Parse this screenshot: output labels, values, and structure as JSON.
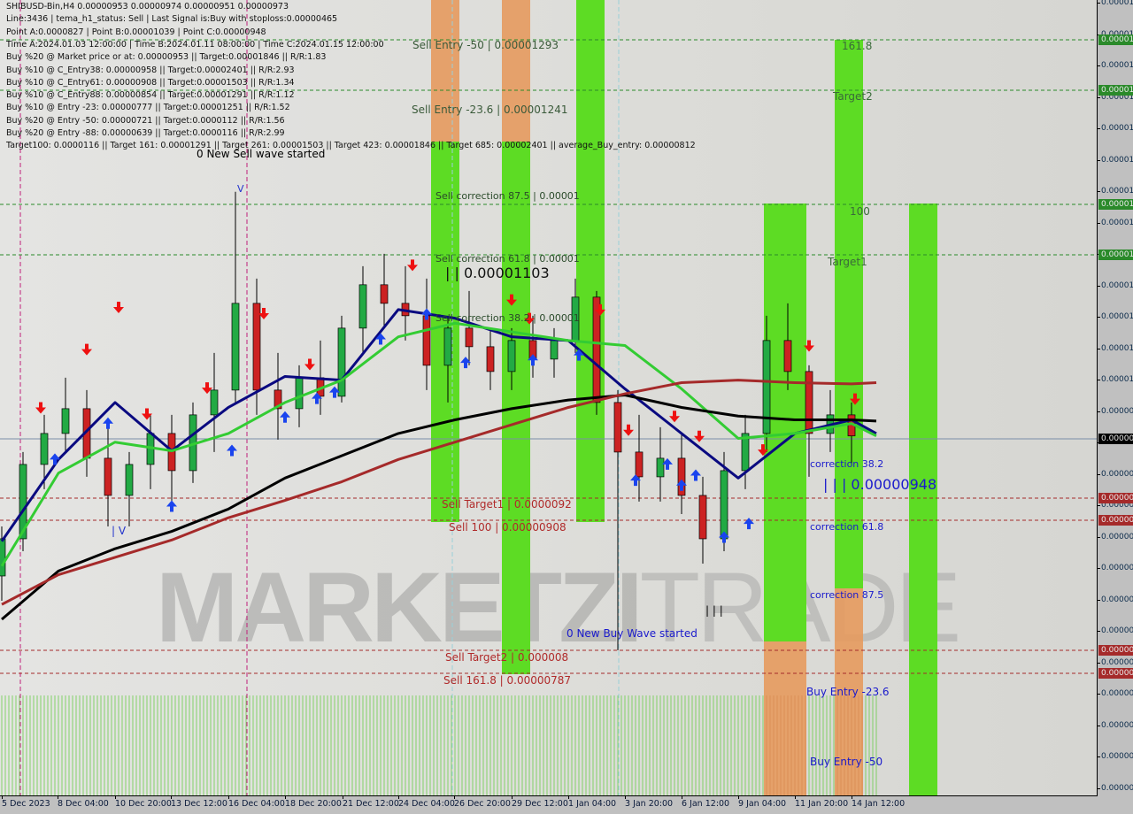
{
  "header": {
    "lines": [
      "SHIBUSD-Bin,H4  0.00000953 0.00000974 0.00000951 0.00000973",
      "Line:3436 | tema_h1_status: Sell | Last Signal is:Buy with stoploss:0.00000465",
      "Point A:0.0000827 | Point B:0.00001039 | Point C:0.00000948",
      "Time A:2024.01.03 12:00:00 | Time B:2024.01.11 08:00:00 | Time C:2024.01.15 12:00:00",
      "Buy %20 @ Market price or at: 0.00000953 || Target:0.00001846 || R/R:1.83",
      "Buy %10 @ C_Entry38: 0.00000958 || Target:0.00002401 || R/R:2.93",
      "Buy %10 @ C_Entry61: 0.00000908 || Target:0.00001503 || R/R:1.34",
      "Buy %10 @ C_Entry88: 0.00000854 || Target:0.00001291 || R/R:1.12",
      "Buy %10 @ Entry -23: 0.00000777 || Target:0.00001251 || R/R:1.52",
      "Buy %20 @ Entry -50: 0.00000721 || Target:0.0000112 || R/R:1.56",
      "Buy %20 @ Entry -88: 0.00000639 || Target:0.0000116 || R/R:2.99",
      "Target100: 0.0000116 || Target 161: 0.00001291 || Target 261: 0.00001503 || Target 423: 0.00001846 || Target 685: 0.00002401 || average_Buy_entry: 0.00000812"
    ]
  },
  "annotations": {
    "sell_entry_50": "Sell Entry -50 | 0.00001293",
    "sell_entry_236": "Sell Entry -23.6 | 0.00001241",
    "sell_corr_875": "Sell correction 87.5 | 0.00001",
    "sell_corr_618": "Sell correction 61.8 | 0.00001",
    "sell_corr_382": "Sell correction 38.2 | 0.00001",
    "point_b": "| | 0.00001103",
    "point_c": "| | | 0.00000948",
    "new_sell_wave": "0 New Sell wave started",
    "new_buy_wave": "0 New Buy Wave started",
    "sell_target1": "Sell Target1 | 0.0000092",
    "sell_100": "Sell 100 | 0.00000908",
    "sell_target2": "Sell Target2 | 0.000008",
    "sell_1618": "Sell 161.8 | 0.00000787",
    "t1618": "161.8",
    "target2": "Target2",
    "t100": "100",
    "target1": "Target1",
    "corr382": "correction 38.2",
    "corr618": "correction 61.8",
    "corr875": "correction 87.5",
    "buy_entry_236": "Buy Entry -23.6",
    "buy_entry_50": "Buy Entry -50",
    "marker_a": "| V",
    "marker_b": "V",
    "marker_c": "| | |"
  },
  "watermark": {
    "bold": "MARKETZI",
    "light": "TRADE"
  },
  "axis": {
    "y_tick_labels": [
      "0.00001",
      "0.00001",
      "0.00001",
      "0.00001",
      "0.00001",
      "0.00001",
      "0.00001",
      "0.00001",
      "0.00001",
      "0.00001",
      "0.00001",
      "0.00001",
      "0.00001",
      "0.00000",
      "0.00000",
      "0.00000",
      "0.00000",
      "0.00000",
      "0.00000",
      "0.00000",
      "0.00000",
      "0.00000",
      "0.00000",
      "0.00000",
      "0.00000",
      "0.00000"
    ],
    "level_tags": [
      {
        "text": "0.00001",
        "color": "#2a8a2a"
      },
      {
        "text": "0.00001",
        "color": "#2a8a2a"
      },
      {
        "text": "0.00001",
        "color": "#2a8a2a"
      },
      {
        "text": "0.00001",
        "color": "#2a8a2a"
      },
      {
        "text": "0.00000",
        "color": "#000000"
      },
      {
        "text": "0.00000",
        "color": "#a52a2a"
      },
      {
        "text": "0.00000",
        "color": "#a52a2a"
      },
      {
        "text": "0.00000",
        "color": "#a52a2a"
      },
      {
        "text": "0.00000",
        "color": "#a52a2a"
      }
    ],
    "x_tick_labels": [
      "5 Dec 2023",
      "8 Dec 04:00",
      "10 Dec 20:00",
      "13 Dec 12:00",
      "16 Dec 04:00",
      "18 Dec 20:00",
      "21 Dec 12:00",
      "24 Dec 04:00",
      "26 Dec 20:00",
      "29 Dec 12:00",
      "1 Jan 04:00",
      "3 Jan 20:00",
      "6 Jan 12:00",
      "9 Jan 04:00",
      "11 Jan 20:00",
      "14 Jan 12:00"
    ]
  },
  "chart_data": {
    "type": "candlestick",
    "title": "SHIBUSD-Bin,H4",
    "timeframe": "H4",
    "current_price": 9.73e-06,
    "levels": [
      {
        "name": "Sell Entry -50",
        "price": 1.293e-05,
        "color": "#2a8a2a"
      },
      {
        "name": "Sell Entry -23.6",
        "price": 1.241e-05,
        "color": "#2a8a2a"
      },
      {
        "name": "Sell correction 87.5",
        "price": 1.18e-05,
        "color": "#2a8a2a"
      },
      {
        "name": "Sell correction 61.8",
        "price": 1.14e-05,
        "color": "#2a8a2a"
      },
      {
        "name": "Sell Target1",
        "price": 9.2e-06,
        "color": "#a52a2a"
      },
      {
        "name": "Sell 100",
        "price": 9.08e-06,
        "color": "#a52a2a"
      },
      {
        "name": "Sell Target2",
        "price": 8e-06,
        "color": "#a52a2a"
      },
      {
        "name": "Sell 161.8",
        "price": 7.87e-06,
        "color": "#a52a2a"
      }
    ],
    "candles": {
      "dates": [
        "2023-12-05T12:00",
        "2023-12-06T12:00",
        "2023-12-07T12:00",
        "2023-12-08T12:00",
        "2023-12-09T12:00",
        "2023-12-10T12:00",
        "2023-12-11T12:00",
        "2023-12-12T12:00",
        "2023-12-13T12:00",
        "2023-12-14T12:00",
        "2023-12-15T12:00",
        "2023-12-16T12:00",
        "2023-12-17T12:00",
        "2023-12-18T12:00",
        "2023-12-19T12:00",
        "2023-12-20T12:00",
        "2023-12-21T12:00",
        "2023-12-22T12:00",
        "2023-12-23T12:00",
        "2023-12-24T12:00",
        "2023-12-25T12:00",
        "2023-12-26T12:00",
        "2023-12-27T12:00",
        "2023-12-28T12:00",
        "2023-12-29T12:00",
        "2023-12-30T12:00",
        "2023-12-31T12:00",
        "2024-01-01T12:00",
        "2024-01-02T12:00",
        "2024-01-03T12:00",
        "2024-01-04T12:00",
        "2024-01-05T12:00",
        "2024-01-06T12:00",
        "2024-01-07T12:00",
        "2024-01-08T12:00",
        "2024-01-09T12:00",
        "2024-01-10T12:00",
        "2024-01-11T12:00",
        "2024-01-12T12:00",
        "2024-01-13T12:00",
        "2024-01-14T12:00"
      ],
      "open": [
        8.6e-06,
        8.9e-06,
        9.5e-06,
        9.75e-06,
        9.95e-06,
        9.55e-06,
        9.25e-06,
        9.5e-06,
        9.75e-06,
        9.45e-06,
        9.9e-06,
        1.01e-05,
        1.08e-05,
        1.01e-05,
        9.95e-06,
        1.02e-05,
        1.005e-05,
        1.06e-05,
        1.095e-05,
        1.08e-05,
        1.07e-05,
        1.03e-05,
        1.06e-05,
        1.045e-05,
        1.025e-05,
        1.05e-05,
        1.035e-05,
        1.05e-05,
        1.085e-05,
        1e-05,
        9.6e-06,
        9.4e-06,
        9.55e-06,
        9.25e-06,
        8.9e-06,
        9.45e-06,
        9.75e-06,
        1.05e-05,
        1.025e-05,
        9.75e-06,
        9.9e-06
      ],
      "high": [
        9e-06,
        9.6e-06,
        9.9e-06,
        1.02e-05,
        1.01e-05,
        9.8e-06,
        9.6e-06,
        9.9e-06,
        9.9e-06,
        1e-05,
        1.04e-05,
        1.17e-05,
        1.1e-05,
        1.04e-05,
        1.03e-05,
        1.05e-05,
        1.07e-05,
        1.11e-05,
        1.12e-05,
        1.11e-05,
        1.1e-05,
        1.07e-05,
        1.09e-05,
        1.06e-05,
        1.06e-05,
        1.07e-05,
        1.06e-05,
        1.1e-05,
        1.09e-05,
        1.01e-05,
        9.9e-06,
        9.8e-06,
        9.75e-06,
        9.4e-06,
        9.6e-06,
        9.9e-06,
        1.07e-05,
        1.08e-05,
        1.03e-05,
        1.01e-05,
        1e-05
      ],
      "low": [
        8.4e-06,
        8.8e-06,
        9.3e-06,
        9.6e-06,
        9.4e-06,
        9e-06,
        9e-06,
        9.3e-06,
        9.2e-06,
        9.35e-06,
        9.6e-06,
        1e-05,
        9.9e-06,
        9.7e-06,
        9.8e-06,
        9.9e-06,
        1e-05,
        1.04e-05,
        1.06e-05,
        1.05e-05,
        1.01e-05,
        1e-05,
        1.03e-05,
        1.01e-05,
        1.01e-05,
        1.02e-05,
        1.02e-05,
        1.04e-05,
        9.9e-06,
        8e-06,
        9.2e-06,
        9.2e-06,
        9.1e-06,
        8.7e-06,
        8.8e-06,
        9.3e-06,
        9.6e-06,
        1.01e-05,
        9.4e-06,
        9.6e-06,
        9.5e-06
      ],
      "close": [
        8.9e-06,
        9.5e-06,
        9.75e-06,
        9.95e-06,
        9.55e-06,
        9.25e-06,
        9.5e-06,
        9.75e-06,
        9.45e-06,
        9.9e-06,
        1.01e-05,
        1.08e-05,
        1.01e-05,
        9.95e-06,
        1.02e-05,
        1.005e-05,
        1.06e-05,
        1.095e-05,
        1.08e-05,
        1.07e-05,
        1.03e-05,
        1.06e-05,
        1.045e-05,
        1.025e-05,
        1.05e-05,
        1.035e-05,
        1.05e-05,
        1.085e-05,
        1e-05,
        9.6e-06,
        9.4e-06,
        9.55e-06,
        9.25e-06,
        8.9e-06,
        9.45e-06,
        9.75e-06,
        1.05e-05,
        1.025e-05,
        9.75e-06,
        9.9e-06,
        9.73e-06
      ]
    },
    "line_dates": [
      "2023-12-05T12:00",
      "2023-12-08T04:00",
      "2023-12-10T20:00",
      "2023-12-13T12:00",
      "2023-12-16T04:00",
      "2023-12-18T20:00",
      "2023-12-21T12:00",
      "2023-12-24T04:00",
      "2023-12-26T20:00",
      "2023-12-29T12:00",
      "2024-01-01T04:00",
      "2024-01-03T20:00",
      "2024-01-06T12:00",
      "2024-01-09T04:00",
      "2024-01-11T20:00",
      "2024-01-14T12:00",
      "2024-01-15T16:00"
    ],
    "series": [
      {
        "color": "#0a0a80",
        "values": [
          8.88e-06,
          9.54e-06,
          1e-05,
          9.61e-06,
          9.96e-06,
          1.021e-05,
          1.018e-05,
          1.075e-05,
          1.068e-05,
          1.053e-05,
          1.05e-05,
          1.011e-05,
          9.75e-06,
          9.39e-06,
          9.75e-06,
          9.86e-06,
          9.75e-06
        ]
      },
      {
        "color": "#33cc33",
        "values": [
          8.68e-06,
          9.43e-06,
          9.68e-06,
          9.61e-06,
          9.75e-06,
          1e-05,
          1.018e-05,
          1.053e-05,
          1.064e-05,
          1.057e-05,
          1.05e-05,
          1.046e-05,
          1.011e-05,
          9.71e-06,
          9.75e-06,
          9.83e-06,
          9.73e-06
        ]
      },
      {
        "color": "#000000",
        "values": [
          8.25e-06,
          8.64e-06,
          8.82e-06,
          8.96e-06,
          9.14e-06,
          9.39e-06,
          9.57e-06,
          9.75e-06,
          9.86e-06,
          9.95e-06,
          1.002e-05,
          1.006e-05,
          9.96e-06,
          9.89e-06,
          9.86e-06,
          9.86e-06,
          9.85e-06
        ]
      },
      {
        "color": "#a52a2a",
        "values": [
          8.37e-06,
          8.61e-06,
          8.75e-06,
          8.89e-06,
          9.07e-06,
          9.21e-06,
          9.36e-06,
          9.54e-06,
          9.68e-06,
          9.82e-06,
          9.96e-06,
          1.007e-05,
          1.016e-05,
          1.018e-05,
          1.016e-05,
          1.015e-05,
          1.016e-05
        ]
      }
    ],
    "sell_signals": [
      {
        "date": "2023-12-07T08:00",
        "price": 9.96e-06
      },
      {
        "date": "2023-12-09T12:00",
        "price": 1.043e-05
      },
      {
        "date": "2023-12-11T00:00",
        "price": 1.077e-05
      },
      {
        "date": "2023-12-12T08:00",
        "price": 9.91e-06
      },
      {
        "date": "2023-12-15T04:00",
        "price": 1.012e-05
      },
      {
        "date": "2023-12-17T20:00",
        "price": 1.072e-05
      },
      {
        "date": "2023-12-20T00:00",
        "price": 1.031e-05
      },
      {
        "date": "2023-12-24T20:00",
        "price": 1.111e-05
      },
      {
        "date": "2023-12-29T12:00",
        "price": 1.083e-05
      },
      {
        "date": "2023-12-30T08:00",
        "price": 1.068e-05
      },
      {
        "date": "2024-01-02T16:00",
        "price": 1.075e-05
      },
      {
        "date": "2024-01-04T00:00",
        "price": 9.78e-06
      },
      {
        "date": "2024-01-06T04:00",
        "price": 9.89e-06
      },
      {
        "date": "2024-01-07T08:00",
        "price": 9.73e-06
      },
      {
        "date": "2024-01-10T08:00",
        "price": 9.62e-06
      },
      {
        "date": "2024-01-12T12:00",
        "price": 1.046e-05
      },
      {
        "date": "2024-01-14T16:00",
        "price": 1.003e-05
      }
    ],
    "buy_signals": [
      {
        "date": "2023-12-08T00:00",
        "price": 9.54e-06
      },
      {
        "date": "2023-12-10T12:00",
        "price": 9.83e-06
      },
      {
        "date": "2023-12-13T12:00",
        "price": 9.16e-06
      },
      {
        "date": "2023-12-16T08:00",
        "price": 9.61e-06
      },
      {
        "date": "2023-12-18T20:00",
        "price": 9.88e-06
      },
      {
        "date": "2023-12-20T08:00",
        "price": 1.003e-05
      },
      {
        "date": "2023-12-21T04:00",
        "price": 1.008e-05
      },
      {
        "date": "2023-12-23T08:00",
        "price": 1.051e-05
      },
      {
        "date": "2023-12-25T12:00",
        "price": 1.071e-05
      },
      {
        "date": "2023-12-27T08:00",
        "price": 1.032e-05
      },
      {
        "date": "2023-12-30T12:00",
        "price": 1.034e-05
      },
      {
        "date": "2024-01-01T16:00",
        "price": 1.038e-05
      },
      {
        "date": "2024-01-04T08:00",
        "price": 9.37e-06
      },
      {
        "date": "2024-01-05T20:00",
        "price": 9.5e-06
      },
      {
        "date": "2024-01-06T12:00",
        "price": 9.33e-06
      },
      {
        "date": "2024-01-07T04:00",
        "price": 9.41e-06
      },
      {
        "date": "2024-01-08T12:00",
        "price": 8.91e-06
      },
      {
        "date": "2024-01-09T16:00",
        "price": 9.02e-06
      }
    ],
    "colors": {
      "bull": "#22aa44",
      "bear": "#cc2222",
      "band_green": "#5ddc24",
      "band_orange": "#e69a5e"
    },
    "grid": false,
    "legend": "none"
  }
}
